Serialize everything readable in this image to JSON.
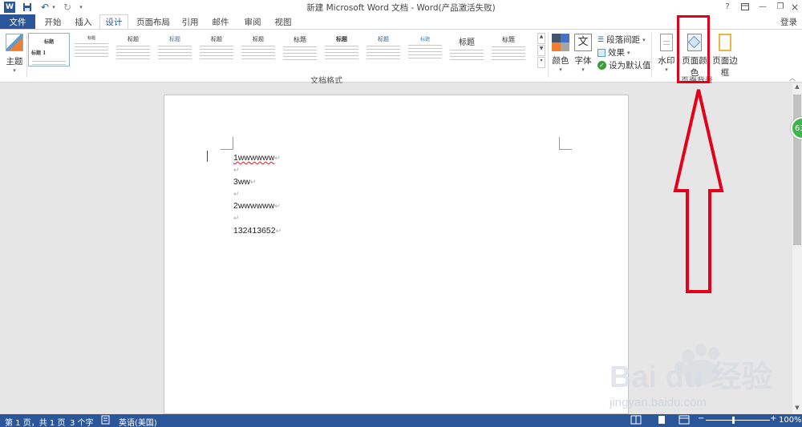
{
  "titlebar": {
    "title": "新建 Microsoft Word 文档 - Word(产品激活失败)",
    "help": "?"
  },
  "tabs": {
    "file": "文件",
    "items": [
      "开始",
      "插入",
      "设计",
      "页面布局",
      "引用",
      "邮件",
      "审阅",
      "视图"
    ],
    "login": "登录"
  },
  "ribbon": {
    "theme_label": "主题",
    "styles": {
      "selected_heading": "标题",
      "selected_sub": "标题 1",
      "headings": [
        "标题",
        "标题",
        "标题",
        "标题",
        "标题",
        "标题",
        "标题",
        "标题",
        "标题",
        "标题",
        "标题",
        "标题"
      ],
      "group_label": "文档格式"
    },
    "colors_label": "颜色",
    "fonts_label": "字体",
    "paragraph_spacing": "段落间距",
    "effects": "效果",
    "set_default": "设为默认值",
    "watermark_label": "水印",
    "page_color_label": "页面颜色",
    "page_borders_label": "页面边框",
    "page_bg_group_label": "页面背景"
  },
  "document": {
    "lines": [
      "1wwwwww",
      "",
      "3ww",
      "",
      "2wwwwww",
      "",
      "132413652"
    ]
  },
  "statusbar": {
    "page": "第 1 页，共 1 页",
    "words": "3 个字",
    "language": "英语(美国)",
    "zoom": "100%"
  },
  "overlay": {
    "badge_text": "63",
    "watermark_brand": "Bai du 经验",
    "watermark_url": "jingyan.baidu.com"
  },
  "colors": {
    "accent": "#2b579a",
    "annotation_red": "#e3001b"
  }
}
